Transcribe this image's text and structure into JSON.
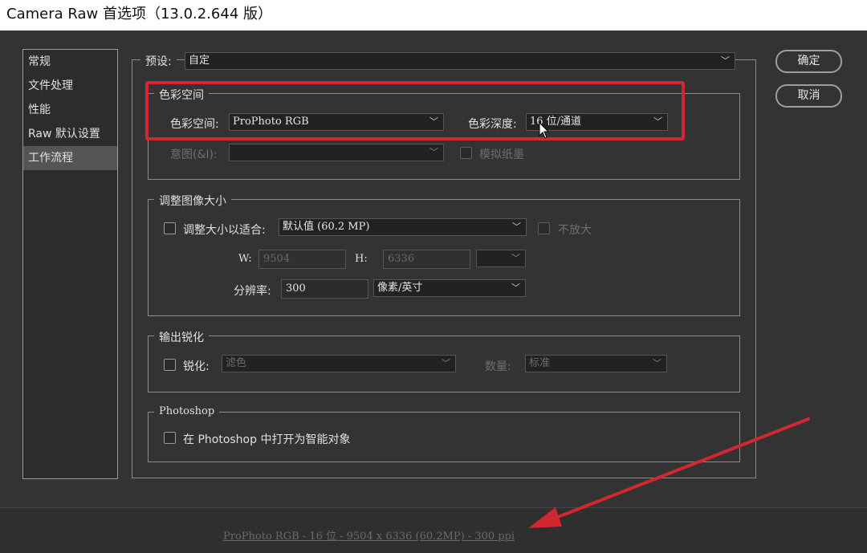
{
  "window": {
    "title": "Camera Raw 首选项（13.0.2.644 版）"
  },
  "sidebar": {
    "items": [
      {
        "label": "常规"
      },
      {
        "label": "文件处理"
      },
      {
        "label": "性能"
      },
      {
        "label": "Raw 默认设置"
      },
      {
        "label": "工作流程"
      }
    ],
    "active_index": 4
  },
  "preset": {
    "label": "预设:",
    "value": "自定"
  },
  "buttons": {
    "ok": "确定",
    "cancel": "取消"
  },
  "color_space": {
    "title": "色彩空间",
    "space_label": "色彩空间:",
    "space_value": "ProPhoto RGB",
    "depth_label": "色彩深度:",
    "depth_value": "16 位/通道",
    "intent_label": "意图(&I):",
    "intent_value": "",
    "simulate_paper_label": "模拟纸墨"
  },
  "resize": {
    "title": "调整图像大小",
    "fit_label": "调整大小以适合:",
    "fit_value": "默认值 (60.2 MP)",
    "no_enlarge_label": "不放大",
    "w_label": "W:",
    "w_value": "9504",
    "h_label": "H:",
    "h_value": "6336",
    "unit_value": "",
    "resolution_label": "分辨率:",
    "resolution_value": "300",
    "resolution_unit": "像素/英寸"
  },
  "sharpen": {
    "title": "输出锐化",
    "sharpen_label": "锐化:",
    "sharpen_value": "滤色",
    "amount_label": "数量:",
    "amount_value": "标准"
  },
  "photoshop": {
    "title": "Photoshop",
    "smart_object_label": "在 Photoshop 中打开为智能对象"
  },
  "footer": {
    "summary": "ProPhoto RGB - 16 位 - 9504 x 6336 (60.2MP) - 300 ppi"
  },
  "colors": {
    "highlight": "#d22630",
    "background": "#333333"
  }
}
